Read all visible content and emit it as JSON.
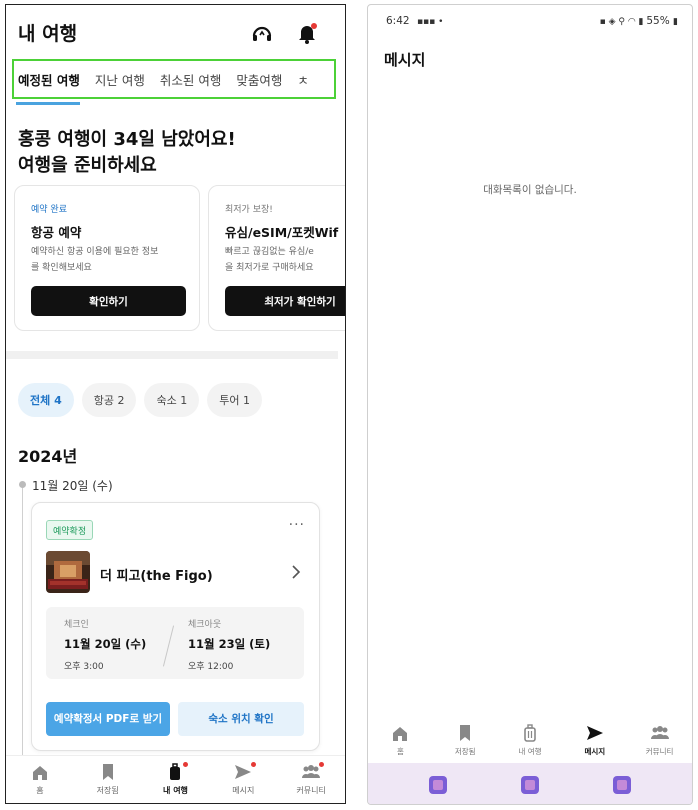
{
  "left": {
    "header": {
      "title": "내 여행"
    },
    "tabs": [
      "예정된 여행",
      "지난 여행",
      "취소된 여행",
      "맞춤여행",
      "ㅊ"
    ],
    "hero": {
      "line1": "홍콩 여행이 34일 남았어요!",
      "line2": "여행을 준비하세요"
    },
    "cards": [
      {
        "tag": "예약 완료",
        "title": "항공 예약",
        "desc": "예약하신 항공 이용에 필요한 정보\n를 확인해보세요",
        "button": "확인하기"
      },
      {
        "tag": "최저가 보장!",
        "title": "유심/eSIM/포켓Wif",
        "desc": "빠르고 끊김없는 유심/e\n을 최저가로 구매하세요",
        "button": "최저가 확인하기"
      }
    ],
    "filters": [
      "전체 4",
      "항공 2",
      "숙소 1",
      "투어 1"
    ],
    "year": "2024년",
    "date_header": "11월 20일 (수)",
    "reservation": {
      "badge": "예약확정",
      "menu": "···",
      "hotel": "더 피고(the Figo)",
      "checkin_label": "체크인",
      "checkin_date": "11월 20일 (수)",
      "checkin_time": "오후 3:00",
      "checkout_label": "체크아웃",
      "checkout_date": "11월 23일 (토)",
      "checkout_time": "오후 12:00",
      "pdf_button": "예약확정서 PDF로 받기",
      "location_button": "숙소 위치 확인"
    },
    "nav": [
      "홈",
      "저장됨",
      "내 여행",
      "메시지",
      "커뮤니티"
    ],
    "colors": {
      "accent": "#4aa3df",
      "tab_highlight": "#4cd137",
      "badge_green": "#1d9a5b",
      "notify": "#e53935"
    }
  },
  "right": {
    "status": {
      "time": "6:42",
      "battery": "55%"
    },
    "title": "메시지",
    "empty_text": "대화목록이 없습니다.",
    "nav": [
      "홈",
      "저장됨",
      "내 여행",
      "메시지",
      "커뮤니티"
    ]
  }
}
